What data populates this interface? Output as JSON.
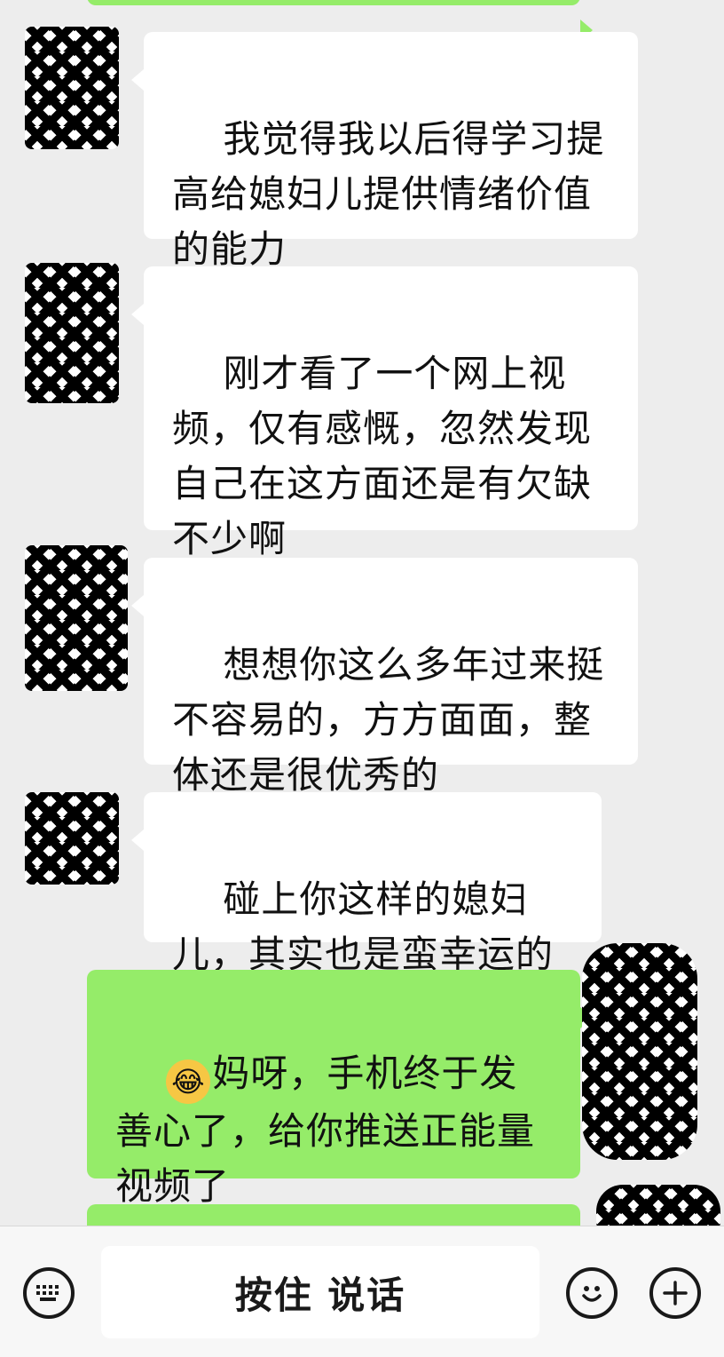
{
  "messages": [
    {
      "side": "in",
      "text": "我觉得我以后得学习提高给媳妇儿提供情绪价值的能力"
    },
    {
      "side": "in",
      "text": "刚才看了一个网上视频，仅有感慨，忽然发现自己在这方面还是有欠缺不少啊"
    },
    {
      "side": "in",
      "text": "想想你这么多年过来挺不容易的，方方面面，整体还是很优秀的"
    },
    {
      "side": "in",
      "text": "碰上你这样的媳妇儿，其实也是蛮幸运的"
    },
    {
      "side": "out",
      "emoji": "😂",
      "emoji_name": "face-with-tears-of-joy",
      "text": "妈呀，手机终于发善心了，给你推送正能量视频了"
    }
  ],
  "input_bar": {
    "voice_button_label": "按住 说话",
    "left_icon": "keyboard-icon",
    "emoji_icon": "smiley-icon",
    "plus_icon": "plus-icon"
  },
  "colors": {
    "background": "#ededed",
    "incoming_bubble": "#ffffff",
    "outgoing_bubble": "#95ec69"
  }
}
